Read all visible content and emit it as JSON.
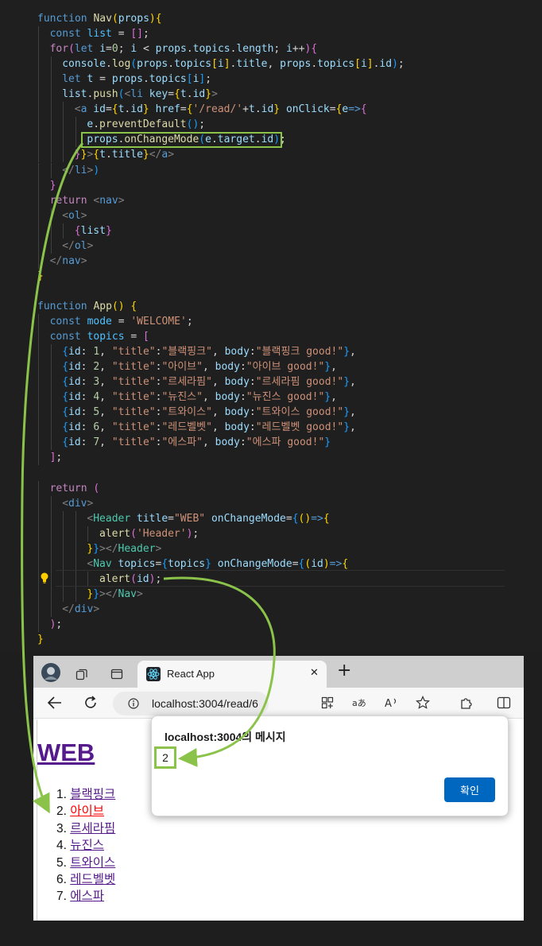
{
  "code_lines": [
    [
      [
        "kw",
        "function "
      ],
      [
        "fn",
        "Nav"
      ],
      [
        "br1",
        "("
      ],
      [
        "var",
        "props"
      ],
      [
        "br1",
        ")"
      ],
      [
        "br1",
        "{"
      ]
    ],
    [
      [
        "kw",
        "const "
      ],
      [
        "cst",
        "list"
      ],
      [
        "plain",
        " = "
      ],
      [
        "br2",
        "[]"
      ],
      [
        "plain",
        ";"
      ]
    ],
    [
      [
        "ctl",
        "for"
      ],
      [
        "br2",
        "("
      ],
      [
        "kw",
        "let "
      ],
      [
        "var",
        "i"
      ],
      [
        "plain",
        "="
      ],
      [
        "num",
        "0"
      ],
      [
        "plain",
        "; "
      ],
      [
        "var",
        "i"
      ],
      [
        "plain",
        " < "
      ],
      [
        "var",
        "props"
      ],
      [
        "plain",
        "."
      ],
      [
        "var",
        "topics"
      ],
      [
        "plain",
        "."
      ],
      [
        "var",
        "length"
      ],
      [
        "plain",
        "; "
      ],
      [
        "var",
        "i"
      ],
      [
        "plain",
        "++"
      ],
      [
        "br2",
        ")"
      ],
      [
        "br2",
        "{"
      ]
    ],
    [
      [
        "var",
        "console"
      ],
      [
        "plain",
        "."
      ],
      [
        "fn",
        "log"
      ],
      [
        "br3",
        "("
      ],
      [
        "var",
        "props"
      ],
      [
        "plain",
        "."
      ],
      [
        "var",
        "topics"
      ],
      [
        "br1",
        "["
      ],
      [
        "var",
        "i"
      ],
      [
        "br1",
        "]"
      ],
      [
        "plain",
        "."
      ],
      [
        "var",
        "title"
      ],
      [
        "plain",
        ", "
      ],
      [
        "var",
        "props"
      ],
      [
        "plain",
        "."
      ],
      [
        "var",
        "topics"
      ],
      [
        "br1",
        "["
      ],
      [
        "var",
        "i"
      ],
      [
        "br1",
        "]"
      ],
      [
        "plain",
        "."
      ],
      [
        "var",
        "id"
      ],
      [
        "br3",
        ")"
      ],
      [
        "plain",
        ";"
      ]
    ],
    [
      [
        "kw",
        "let "
      ],
      [
        "var",
        "t"
      ],
      [
        "plain",
        " = "
      ],
      [
        "var",
        "props"
      ],
      [
        "plain",
        "."
      ],
      [
        "var",
        "topics"
      ],
      [
        "br3",
        "["
      ],
      [
        "var",
        "i"
      ],
      [
        "br3",
        "]"
      ],
      [
        "plain",
        ";"
      ]
    ],
    [
      [
        "var",
        "list"
      ],
      [
        "plain",
        "."
      ],
      [
        "fn",
        "push"
      ],
      [
        "br3",
        "("
      ],
      [
        "tagp",
        "<"
      ],
      [
        "kw",
        "li "
      ],
      [
        "var",
        "key"
      ],
      [
        "plain",
        "="
      ],
      [
        "br1",
        "{"
      ],
      [
        "var",
        "t"
      ],
      [
        "plain",
        "."
      ],
      [
        "var",
        "id"
      ],
      [
        "br1",
        "}"
      ],
      [
        "tagp",
        ">"
      ]
    ],
    [
      [
        "tagp",
        "<"
      ],
      [
        "kw",
        "a "
      ],
      [
        "var",
        "id"
      ],
      [
        "plain",
        "="
      ],
      [
        "br1",
        "{"
      ],
      [
        "var",
        "t"
      ],
      [
        "plain",
        "."
      ],
      [
        "var",
        "id"
      ],
      [
        "br1",
        "}"
      ],
      [
        "plain",
        " "
      ],
      [
        "var",
        "href"
      ],
      [
        "plain",
        "="
      ],
      [
        "br1",
        "{"
      ],
      [
        "str",
        "'/read/'"
      ],
      [
        "plain",
        "+"
      ],
      [
        "var",
        "t"
      ],
      [
        "plain",
        "."
      ],
      [
        "var",
        "id"
      ],
      [
        "br1",
        "}"
      ],
      [
        "plain",
        " "
      ],
      [
        "var",
        "onClick"
      ],
      [
        "plain",
        "="
      ],
      [
        "br1",
        "{"
      ],
      [
        "var",
        "e"
      ],
      [
        "kw",
        "=>"
      ],
      [
        "br2",
        "{"
      ]
    ],
    [
      [
        "var",
        "e"
      ],
      [
        "plain",
        "."
      ],
      [
        "fn",
        "preventDefault"
      ],
      [
        "br3",
        "()"
      ],
      [
        "plain",
        ";"
      ]
    ],
    [
      [
        "var",
        "props"
      ],
      [
        "plain",
        "."
      ],
      [
        "fn",
        "onChangeMode"
      ],
      [
        "br3",
        "("
      ],
      [
        "var",
        "e"
      ],
      [
        "plain",
        "."
      ],
      [
        "var",
        "target"
      ],
      [
        "plain",
        "."
      ],
      [
        "var",
        "id"
      ],
      [
        "br3",
        ")"
      ],
      [
        "plain",
        ";"
      ]
    ],
    [
      [
        "br2",
        "}"
      ],
      [
        "br1",
        "}"
      ],
      [
        "tagp",
        ">"
      ],
      [
        "br1",
        "{"
      ],
      [
        "var",
        "t"
      ],
      [
        "plain",
        "."
      ],
      [
        "var",
        "title"
      ],
      [
        "br1",
        "}"
      ],
      [
        "tagp",
        "</"
      ],
      [
        "kw",
        "a"
      ],
      [
        "tagp",
        ">"
      ]
    ],
    [
      [
        "tagp",
        "</"
      ],
      [
        "kw",
        "li"
      ],
      [
        "tagp",
        ">"
      ],
      [
        "br3",
        ")"
      ]
    ],
    [
      [
        "br2",
        "}"
      ]
    ],
    [
      [
        "ctl",
        "return "
      ],
      [
        "tagp",
        "<"
      ],
      [
        "kw",
        "nav"
      ],
      [
        "tagp",
        ">"
      ]
    ],
    [
      [
        "tagp",
        "<"
      ],
      [
        "kw",
        "ol"
      ],
      [
        "tagp",
        ">"
      ]
    ],
    [
      [
        "br2",
        "{"
      ],
      [
        "var",
        "list"
      ],
      [
        "br2",
        "}"
      ]
    ],
    [
      [
        "tagp",
        "</"
      ],
      [
        "kw",
        "ol"
      ],
      [
        "tagp",
        ">"
      ]
    ],
    [
      [
        "tagp",
        "</"
      ],
      [
        "kw",
        "nav"
      ],
      [
        "tagp",
        ">"
      ]
    ],
    [
      [
        "br1",
        "}"
      ]
    ],
    [],
    [
      [
        "kw",
        "function "
      ],
      [
        "fn",
        "App"
      ],
      [
        "br1",
        "()"
      ],
      [
        "plain",
        " "
      ],
      [
        "br1",
        "{"
      ]
    ],
    [
      [
        "kw",
        "const "
      ],
      [
        "cst",
        "mode"
      ],
      [
        "plain",
        " = "
      ],
      [
        "str",
        "'WELCOME'"
      ],
      [
        "plain",
        ";"
      ]
    ],
    [
      [
        "kw",
        "const "
      ],
      [
        "cst",
        "topics"
      ],
      [
        "plain",
        " = "
      ],
      [
        "br2",
        "["
      ]
    ],
    [
      [
        "br3",
        "{"
      ],
      [
        "var",
        "id"
      ],
      [
        "plain",
        ": "
      ],
      [
        "num",
        "1"
      ],
      [
        "plain",
        ", "
      ],
      [
        "str",
        "\"title\""
      ],
      [
        "plain",
        ":"
      ],
      [
        "str",
        "\"블랙핑크\""
      ],
      [
        "plain",
        ", "
      ],
      [
        "var",
        "body"
      ],
      [
        "plain",
        ":"
      ],
      [
        "str",
        "\"블랙핑크 good!\""
      ],
      [
        "br3",
        "}"
      ],
      [
        "plain",
        ","
      ]
    ],
    [
      [
        "br3",
        "{"
      ],
      [
        "var",
        "id"
      ],
      [
        "plain",
        ": "
      ],
      [
        "num",
        "2"
      ],
      [
        "plain",
        ", "
      ],
      [
        "str",
        "\"title\""
      ],
      [
        "plain",
        ":"
      ],
      [
        "str",
        "\"아이브\""
      ],
      [
        "plain",
        ", "
      ],
      [
        "var",
        "body"
      ],
      [
        "plain",
        ":"
      ],
      [
        "str",
        "\"아이브 good!\""
      ],
      [
        "br3",
        "}"
      ],
      [
        "plain",
        ","
      ]
    ],
    [
      [
        "br3",
        "{"
      ],
      [
        "var",
        "id"
      ],
      [
        "plain",
        ": "
      ],
      [
        "num",
        "3"
      ],
      [
        "plain",
        ", "
      ],
      [
        "str",
        "\"title\""
      ],
      [
        "plain",
        ":"
      ],
      [
        "str",
        "\"르세라핌\""
      ],
      [
        "plain",
        ", "
      ],
      [
        "var",
        "body"
      ],
      [
        "plain",
        ":"
      ],
      [
        "str",
        "\"르세라핌 good!\""
      ],
      [
        "br3",
        "}"
      ],
      [
        "plain",
        ","
      ]
    ],
    [
      [
        "br3",
        "{"
      ],
      [
        "var",
        "id"
      ],
      [
        "plain",
        ": "
      ],
      [
        "num",
        "4"
      ],
      [
        "plain",
        ", "
      ],
      [
        "str",
        "\"title\""
      ],
      [
        "plain",
        ":"
      ],
      [
        "str",
        "\"뉴진스\""
      ],
      [
        "plain",
        ", "
      ],
      [
        "var",
        "body"
      ],
      [
        "plain",
        ":"
      ],
      [
        "str",
        "\"뉴진스 good!\""
      ],
      [
        "br3",
        "}"
      ],
      [
        "plain",
        ","
      ]
    ],
    [
      [
        "br3",
        "{"
      ],
      [
        "var",
        "id"
      ],
      [
        "plain",
        ": "
      ],
      [
        "num",
        "5"
      ],
      [
        "plain",
        ", "
      ],
      [
        "str",
        "\"title\""
      ],
      [
        "plain",
        ":"
      ],
      [
        "str",
        "\"트와이스\""
      ],
      [
        "plain",
        ", "
      ],
      [
        "var",
        "body"
      ],
      [
        "plain",
        ":"
      ],
      [
        "str",
        "\"트와이스 good!\""
      ],
      [
        "br3",
        "}"
      ],
      [
        "plain",
        ","
      ]
    ],
    [
      [
        "br3",
        "{"
      ],
      [
        "var",
        "id"
      ],
      [
        "plain",
        ": "
      ],
      [
        "num",
        "6"
      ],
      [
        "plain",
        ", "
      ],
      [
        "str",
        "\"title\""
      ],
      [
        "plain",
        ":"
      ],
      [
        "str",
        "\"레드벨벳\""
      ],
      [
        "plain",
        ", "
      ],
      [
        "var",
        "body"
      ],
      [
        "plain",
        ":"
      ],
      [
        "str",
        "\"레드벨벳 good!\""
      ],
      [
        "br3",
        "}"
      ],
      [
        "plain",
        ","
      ]
    ],
    [
      [
        "br3",
        "{"
      ],
      [
        "var",
        "id"
      ],
      [
        "plain",
        ": "
      ],
      [
        "num",
        "7"
      ],
      [
        "plain",
        ", "
      ],
      [
        "str",
        "\"title\""
      ],
      [
        "plain",
        ":"
      ],
      [
        "str",
        "\"에스파\""
      ],
      [
        "plain",
        ", "
      ],
      [
        "var",
        "body"
      ],
      [
        "plain",
        ":"
      ],
      [
        "str",
        "\"에스파 good!\""
      ],
      [
        "br3",
        "}"
      ]
    ],
    [
      [
        "br2",
        "]"
      ],
      [
        "plain",
        ";"
      ]
    ],
    [],
    [
      [
        "ctl",
        "return "
      ],
      [
        "br2",
        "("
      ]
    ],
    [
      [
        "tagp",
        "<"
      ],
      [
        "kw",
        "div"
      ],
      [
        "tagp",
        ">"
      ]
    ],
    [
      [
        "tagp",
        "<"
      ],
      [
        "tag",
        "Header "
      ],
      [
        "var",
        "title"
      ],
      [
        "plain",
        "="
      ],
      [
        "str",
        "\"WEB\""
      ],
      [
        "plain",
        " "
      ],
      [
        "var",
        "onChangeMode"
      ],
      [
        "plain",
        "="
      ],
      [
        "br3",
        "{"
      ],
      [
        "br1",
        "()"
      ],
      [
        "kw",
        "=>"
      ],
      [
        "br1",
        "{"
      ]
    ],
    [
      [
        "fn",
        "alert"
      ],
      [
        "br2",
        "("
      ],
      [
        "str",
        "'Header'"
      ],
      [
        "br2",
        ")"
      ],
      [
        "plain",
        ";"
      ]
    ],
    [
      [
        "br1",
        "}"
      ],
      [
        "br3",
        "}"
      ],
      [
        "tagp",
        "></"
      ],
      [
        "tag",
        "Header"
      ],
      [
        "tagp",
        ">"
      ]
    ],
    [
      [
        "tagp",
        "<"
      ],
      [
        "tag",
        "Nav "
      ],
      [
        "var",
        "topics"
      ],
      [
        "plain",
        "="
      ],
      [
        "br3",
        "{"
      ],
      [
        "var",
        "topics"
      ],
      [
        "br3",
        "}"
      ],
      [
        "plain",
        " "
      ],
      [
        "var",
        "onChangeMode"
      ],
      [
        "plain",
        "="
      ],
      [
        "br3",
        "{"
      ],
      [
        "br1",
        "("
      ],
      [
        "var",
        "id"
      ],
      [
        "br1",
        ")"
      ],
      [
        "kw",
        "=>"
      ],
      [
        "br1",
        "{"
      ]
    ],
    [
      [
        "fn",
        "alert"
      ],
      [
        "br2",
        "("
      ],
      [
        "var",
        "id"
      ],
      [
        "br2",
        ")"
      ],
      [
        "plain",
        ";"
      ]
    ],
    [
      [
        "br1",
        "}"
      ],
      [
        "br3",
        "}"
      ],
      [
        "tagp",
        "></"
      ],
      [
        "tag",
        "Nav"
      ],
      [
        "tagp",
        ">"
      ]
    ],
    [
      [
        "tagp",
        "</"
      ],
      [
        "kw",
        "div"
      ],
      [
        "tagp",
        ">"
      ]
    ],
    [
      [
        "br2",
        ")"
      ],
      [
        "plain",
        ";"
      ]
    ],
    [
      [
        "br1",
        "}"
      ]
    ]
  ],
  "code_indent": [
    0,
    1,
    1,
    2,
    2,
    2,
    3,
    4,
    4,
    3,
    2,
    1,
    1,
    2,
    3,
    2,
    1,
    0,
    0,
    0,
    1,
    1,
    2,
    2,
    2,
    2,
    2,
    2,
    2,
    1,
    0,
    1,
    2,
    4,
    5,
    4,
    4,
    5,
    4,
    2,
    1,
    0
  ],
  "browser": {
    "tab_title": "React App",
    "tab_close": "✕",
    "new_tab": "+",
    "url": "localhost:3004/read/6",
    "page_heading": "WEB",
    "topics": [
      {
        "num": "1.",
        "title": "블랙핑크",
        "active": false
      },
      {
        "num": "2.",
        "title": "아이브",
        "active": true
      },
      {
        "num": "3.",
        "title": "르세라핌",
        "active": false
      },
      {
        "num": "4.",
        "title": "뉴진스",
        "active": false
      },
      {
        "num": "5.",
        "title": "트와이스",
        "active": false
      },
      {
        "num": "6.",
        "title": "레드벨벳",
        "active": false
      },
      {
        "num": "7.",
        "title": "에스파",
        "active": false
      }
    ]
  },
  "dialog": {
    "title": "localhost:3004의 메시지",
    "message": "2",
    "ok_label": "확인"
  },
  "colors": {
    "annotation": "#8bc34a",
    "editor_bg": "#1f1f1f",
    "ok_button": "#0067c0",
    "visited_link": "#551a8b",
    "active_link": "#ff0000"
  }
}
